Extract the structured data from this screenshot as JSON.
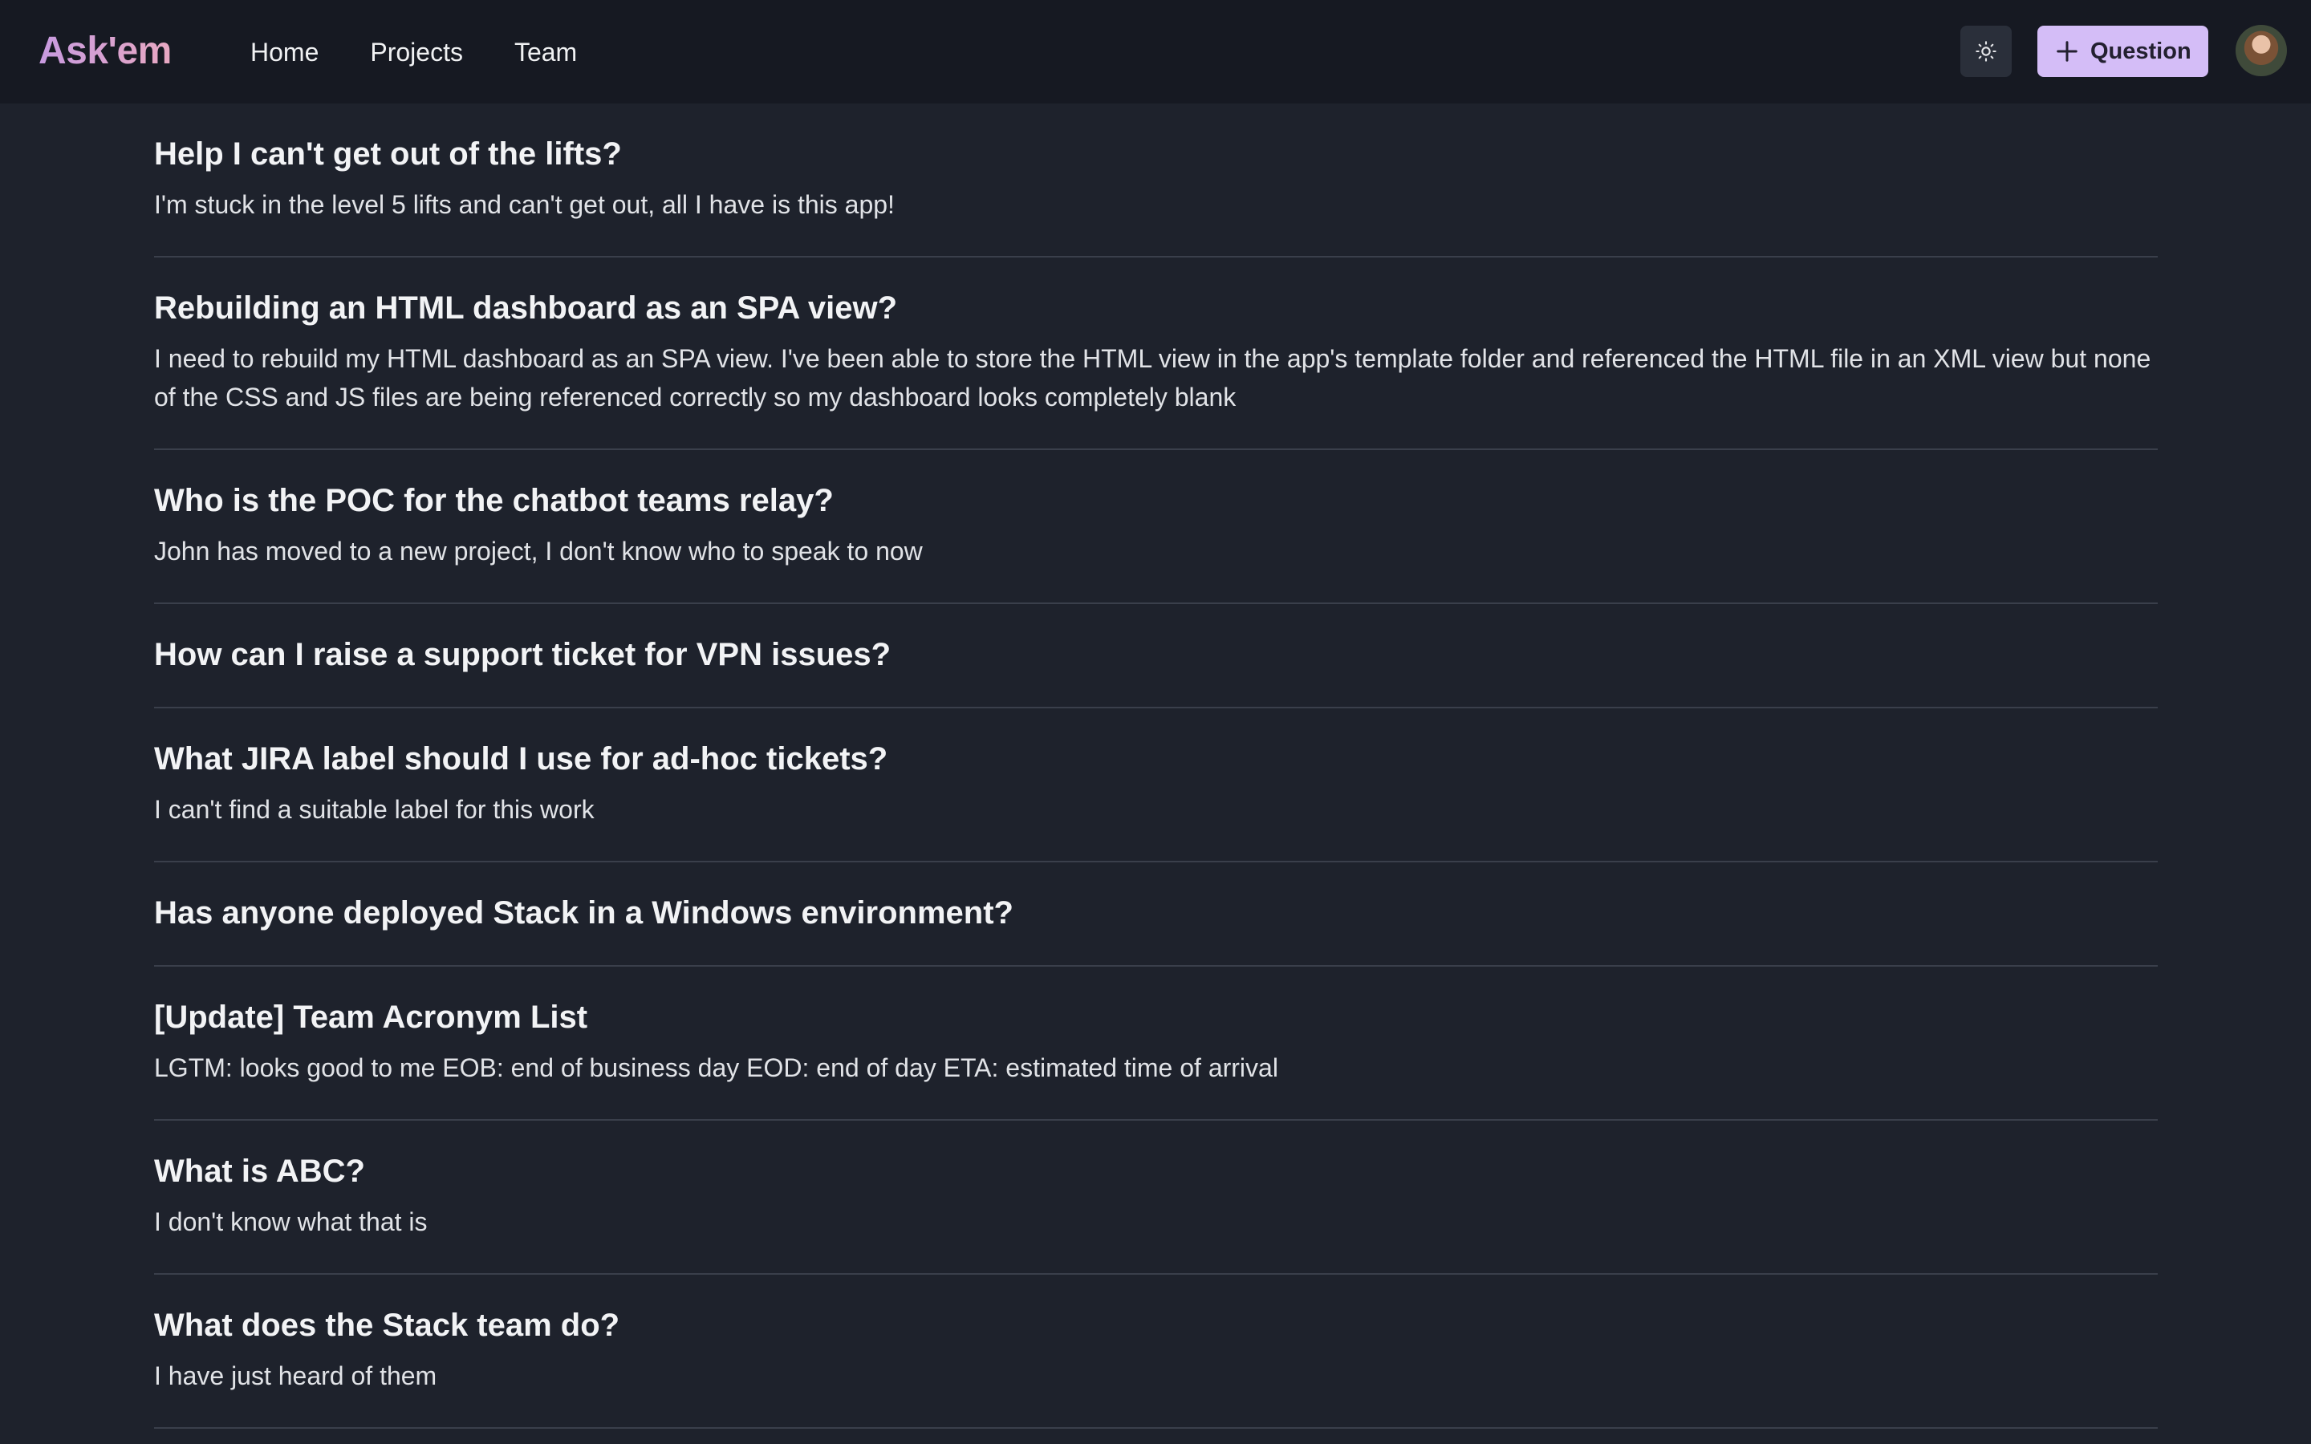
{
  "app": {
    "logo": "Ask'em"
  },
  "nav": {
    "items": [
      "Home",
      "Projects",
      "Team"
    ]
  },
  "header": {
    "theme_toggle_icon": "sun-icon",
    "ask_button_icon": "plus-icon",
    "ask_button_label": "Question",
    "avatar_icon": "user-avatar"
  },
  "questions": [
    {
      "title": "Help I can't get out of the lifts?",
      "body": "I'm stuck in the level 5 lifts and can't get out, all I have is this app!"
    },
    {
      "title": "Rebuilding an HTML dashboard as an SPA view?",
      "body": "I need to rebuild my HTML dashboard as an SPA view. I've been able to store the HTML view in the app's template folder and referenced the HTML file in an XML view but none of the CSS and JS files are being referenced correctly so my dashboard looks completely blank"
    },
    {
      "title": "Who is the POC for the chatbot teams relay?",
      "body": "John has moved to a new project, I don't know who to speak to now"
    },
    {
      "title": "How can I raise a support ticket for VPN issues?",
      "body": ""
    },
    {
      "title": "What JIRA label should I use for ad-hoc tickets?",
      "body": "I can't find a suitable label for this work"
    },
    {
      "title": "Has anyone deployed Stack in a Windows environment?",
      "body": ""
    },
    {
      "title": "[Update] Team Acronym List",
      "body": "LGTM: looks good to me EOB: end of business day EOD: end of day ETA: estimated time of arrival"
    },
    {
      "title": "What is ABC?",
      "body": "I don't know what that is"
    },
    {
      "title": "What does the Stack team do?",
      "body": "I have just heard of them"
    }
  ]
}
